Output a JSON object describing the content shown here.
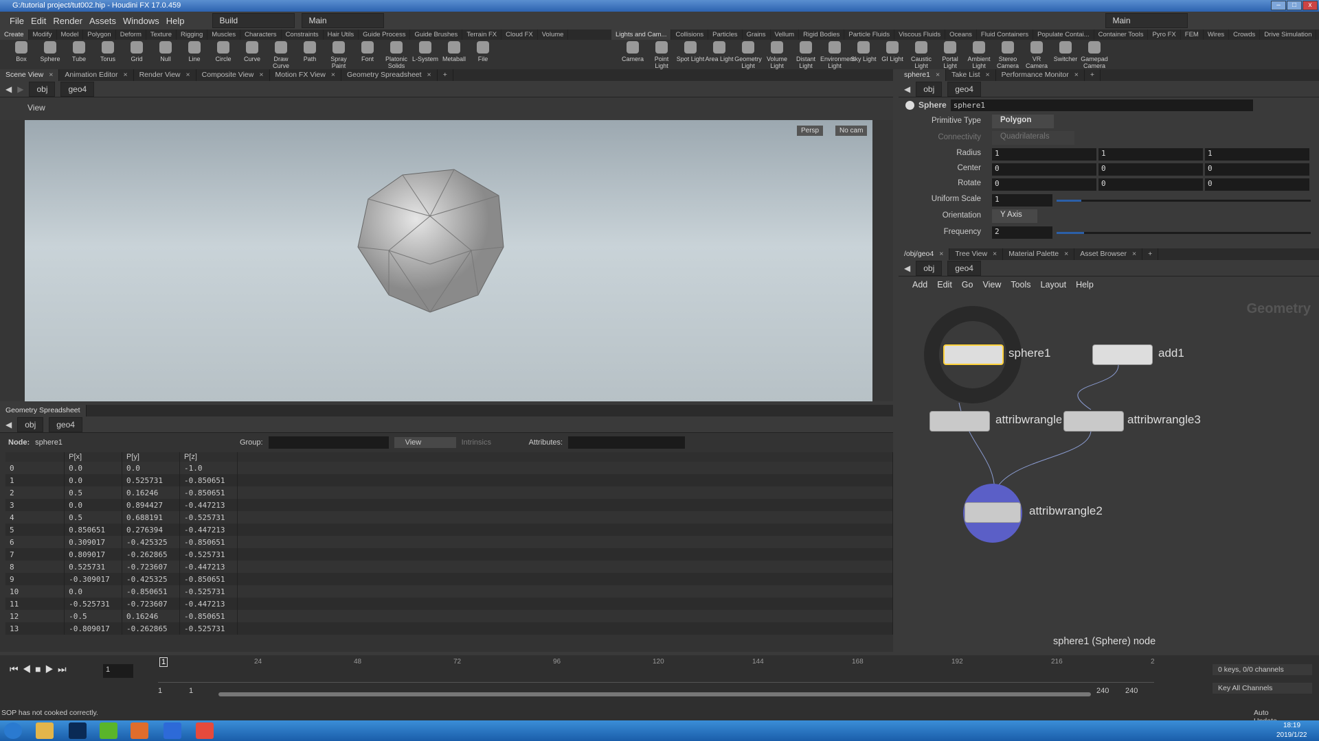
{
  "window": {
    "title": "G:/tutorial project/tut002.hip - Houdini FX 17.0.459"
  },
  "menu": [
    "File",
    "Edit",
    "Render",
    "Assets",
    "Windows",
    "Help"
  ],
  "desktop": "Build",
  "desktop2": "Main",
  "desktop_right": "Main",
  "shelf_left": {
    "tabs": [
      "Create",
      "Modify",
      "Model",
      "Polygon",
      "Deform",
      "Texture",
      "Rigging",
      "Muscles",
      "Characters",
      "Constraints",
      "Hair Utils",
      "Guide Process",
      "Guide Brushes",
      "Terrain FX",
      "Cloud FX",
      "Volume"
    ],
    "tools": [
      "Box",
      "Sphere",
      "Tube",
      "Torus",
      "Grid",
      "Null",
      "Line",
      "Circle",
      "Curve",
      "Draw Curve",
      "Path",
      "Spray Paint",
      "Font",
      "Platonic Solids",
      "L-System",
      "Metaball",
      "File"
    ]
  },
  "shelf_right": {
    "tabs": [
      "Lights and Cam...",
      "Collisions",
      "Particles",
      "Grains",
      "Vellum",
      "Rigid Bodies",
      "Particle Fluids",
      "Viscous Fluids",
      "Oceans",
      "Fluid Containers",
      "Populate Contai...",
      "Container Tools",
      "Pyro FX",
      "FEM",
      "Wires",
      "Crowds",
      "Drive Simulation"
    ],
    "tools": [
      "Camera",
      "Point Light",
      "Spot Light",
      "Area Light",
      "Geometry Light",
      "Volume Light",
      "Distant Light",
      "Environment Light",
      "Sky Light",
      "GI Light",
      "Caustic Light",
      "Portal Light",
      "Ambient Light",
      "Stereo Camera",
      "VR Camera",
      "Switcher",
      "Gamepad Camera"
    ]
  },
  "left_tabs": [
    "Scene View",
    "Animation Editor",
    "Render View",
    "Composite View",
    "Motion FX View",
    "Geometry Spreadsheet"
  ],
  "path": {
    "obj": "obj",
    "geo": "geo4"
  },
  "viewport": {
    "label": "View",
    "persp": "Persp",
    "cam": "No cam"
  },
  "spreadsheet": {
    "tab": "Geometry Spreadsheet",
    "node_label": "Node:",
    "node": "sphere1",
    "group_label": "Group:",
    "view": "View",
    "intrinsics": "Intrinsics",
    "attributes_label": "Attributes:",
    "columns": [
      "",
      "P[x]",
      "P[y]",
      "P[z]"
    ],
    "rows": [
      [
        "0",
        "0.0",
        "0.0",
        "-1.0"
      ],
      [
        "1",
        "0.0",
        "0.525731",
        "-0.850651"
      ],
      [
        "2",
        "0.5",
        "0.16246",
        "-0.850651"
      ],
      [
        "3",
        "0.0",
        "0.894427",
        "-0.447213"
      ],
      [
        "4",
        "0.5",
        "0.688191",
        "-0.525731"
      ],
      [
        "5",
        "0.850651",
        "0.276394",
        "-0.447213"
      ],
      [
        "6",
        "0.309017",
        "-0.425325",
        "-0.850651"
      ],
      [
        "7",
        "0.809017",
        "-0.262865",
        "-0.525731"
      ],
      [
        "8",
        "0.525731",
        "-0.723607",
        "-0.447213"
      ],
      [
        "9",
        "-0.309017",
        "-0.425325",
        "-0.850651"
      ],
      [
        "10",
        "0.0",
        "-0.850651",
        "-0.525731"
      ],
      [
        "11",
        "-0.525731",
        "-0.723607",
        "-0.447213"
      ],
      [
        "12",
        "-0.5",
        "0.16246",
        "-0.850651"
      ],
      [
        "13",
        "-0.809017",
        "-0.262865",
        "-0.525731"
      ]
    ]
  },
  "params": {
    "tabs": [
      "sphere1",
      "Take List",
      "Performance Monitor"
    ],
    "type": "Sphere",
    "name": "sphere1",
    "primitive_type": {
      "label": "Primitive Type",
      "value": "Polygon"
    },
    "connectivity": {
      "label": "Connectivity",
      "value": "Quadrilaterals"
    },
    "radius": {
      "label": "Radius",
      "values": [
        "1",
        "1",
        "1"
      ]
    },
    "center": {
      "label": "Center",
      "values": [
        "0",
        "0",
        "0"
      ]
    },
    "rotate": {
      "label": "Rotate",
      "values": [
        "0",
        "0",
        "0"
      ]
    },
    "uniform_scale": {
      "label": "Uniform Scale",
      "value": "1"
    },
    "orientation": {
      "label": "Orientation",
      "value": "Y Axis"
    },
    "frequency": {
      "label": "Frequency",
      "value": "2"
    }
  },
  "network": {
    "tabs": [
      "/obj/geo4",
      "Tree View",
      "Material Palette",
      "Asset Browser"
    ],
    "menu": [
      "Add",
      "Edit",
      "Go",
      "View",
      "Tools",
      "Layout",
      "Help"
    ],
    "context": "Geometry",
    "nodes": [
      "sphere1",
      "add1",
      "attribwrangle1",
      "attribwrangle3",
      "attribwrangle2"
    ],
    "status": "sphere1 (Sphere) node"
  },
  "timeline": {
    "frame": "1",
    "ticks": [
      "24",
      "48",
      "72",
      "96",
      "120",
      "144",
      "168",
      "192",
      "216",
      "2"
    ],
    "start": "1",
    "start2": "1",
    "end": "240",
    "end2": "240",
    "keys": "0 keys, 0/0 channels",
    "key_all": "Key All Channels",
    "auto_update": "Auto Update"
  },
  "status": "SOP has not cooked correctly.",
  "clock": {
    "time": "18:19",
    "date": "2019/1/22"
  },
  "colors": {
    "accent": "#2d63b0",
    "bg": "#3a3a3a"
  }
}
